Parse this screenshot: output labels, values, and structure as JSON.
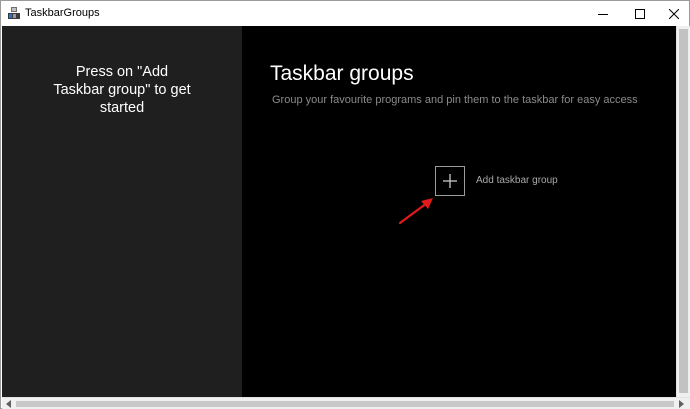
{
  "window": {
    "title": "TaskbarGroups",
    "app_icon": "taskbar-groups-icon",
    "controls": [
      "minimize-icon",
      "maximize-icon",
      "close-icon"
    ]
  },
  "sidebar": {
    "hint": "Press on \"Add Taskbar group\" to get started"
  },
  "main": {
    "title": "Taskbar groups",
    "subtitle": "Group your favourite programs and pin them to the taskbar for easy access",
    "add_button": {
      "icon": "plus-icon",
      "label": "Add taskbar group"
    },
    "annotation_arrow": {
      "icon": "arrow-icon",
      "color": "#e01b1b"
    }
  },
  "colors": {
    "sidebar_bg": "#1f1f1f",
    "main_bg": "#000000",
    "title_text": "#ffffff",
    "subtitle_text": "#8a8a8a"
  }
}
